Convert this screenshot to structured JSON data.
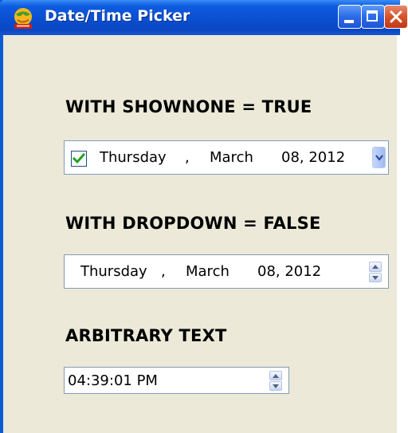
{
  "window": {
    "title": "Date/Time Picker"
  },
  "sections": [
    {
      "heading": "WITH SHOWNONE = TRUE",
      "checked": true,
      "weekday": "Thursday",
      "sep": ",",
      "month": "March",
      "daydate": "08, 2012"
    },
    {
      "heading": "WITH DROPDOWN = FALSE",
      "weekday": "Thursday",
      "sep": ",",
      "month": "March",
      "daydate": "08, 2012"
    },
    {
      "heading": "ARBITRARY TEXT",
      "value": "04:39:01 PM"
    }
  ],
  "icons": {
    "app": "globe-app-icon",
    "minimize": "minimize-icon",
    "maximize": "maximize-icon",
    "close": "close-icon",
    "dropdown": "chevron-down-icon",
    "spin_up": "spin-up-icon",
    "spin_down": "spin-down-icon",
    "check": "check-icon"
  },
  "colors": {
    "titlebar": "#0a4fd0",
    "window_bg": "#ece9d8",
    "close_button": "#d4532c",
    "field_border": "#7f9db9",
    "check_mark": "#21a121"
  }
}
